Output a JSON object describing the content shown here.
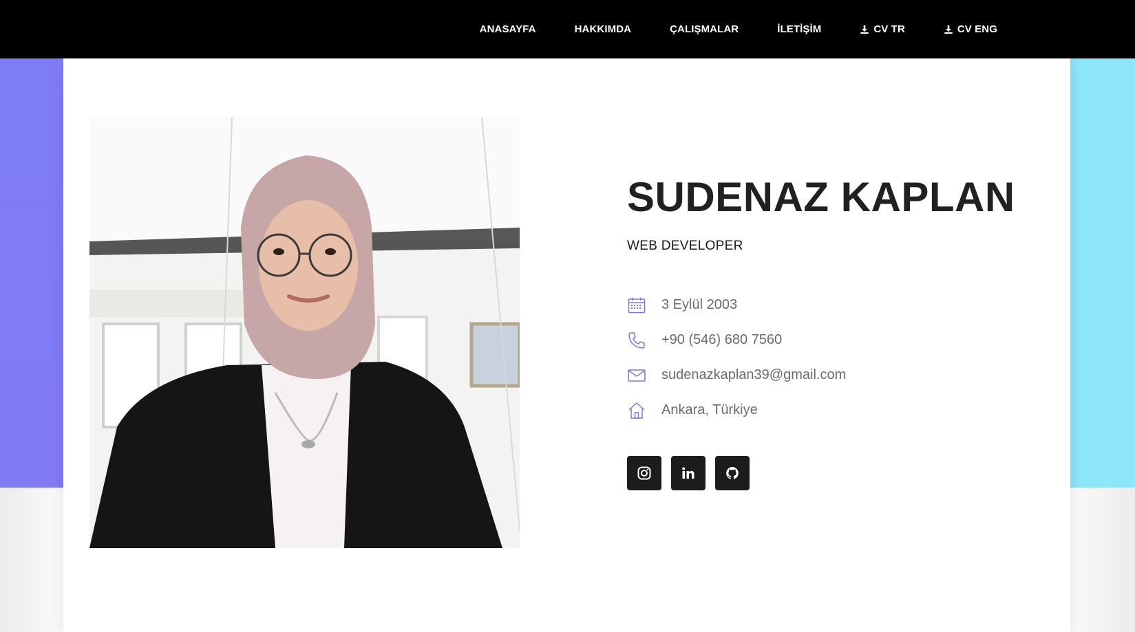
{
  "nav": {
    "items": [
      "ANASAYFA",
      "HAKKIMDA",
      "ÇALIŞMALAR",
      "İLETİŞİM"
    ],
    "cv_tr": "CV TR",
    "cv_eng": "CV ENG"
  },
  "profile": {
    "name": "SUDENAZ KAPLAN",
    "role": "WEB DEVELOPER",
    "birthdate": "3 Eylül 2003",
    "phone": "+90 (546) 680 7560",
    "email": "sudenazkaplan39@gmail.com",
    "location": "Ankara, Türkiye"
  },
  "social": [
    "instagram-icon",
    "linkedin-icon",
    "github-icon"
  ],
  "colors": {
    "topbar": "#000000",
    "accent_icon": "#7b74e8",
    "band_left": "#7f7cf8",
    "band_right": "#8ce5f8",
    "social_btn": "#1c1c1c"
  }
}
